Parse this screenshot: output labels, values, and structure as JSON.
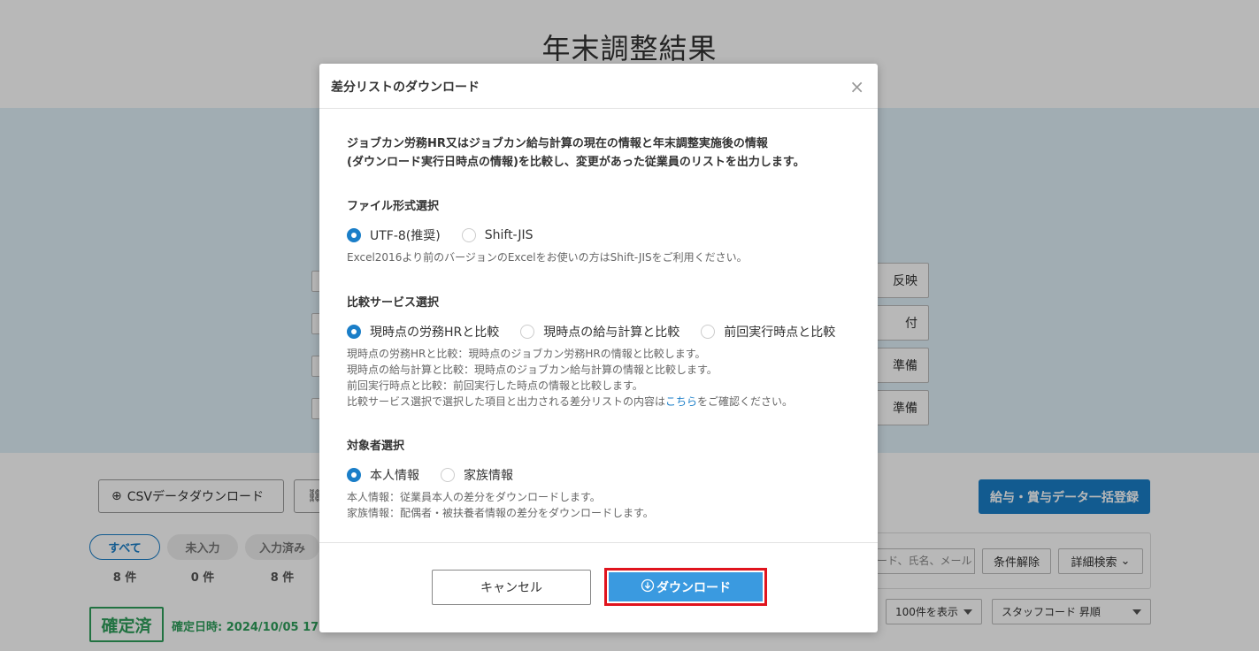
{
  "page": {
    "title": "年末調整結果",
    "right_buttons": [
      "反映",
      "付",
      "準備",
      "準備"
    ]
  },
  "toolbar": {
    "csv_download_label": "CSVデータダウンロード",
    "bulk_register_label": "給与・賞与データ一括登録"
  },
  "filters": [
    {
      "label": "すべて",
      "count": "8 件",
      "active": true
    },
    {
      "label": "未入力",
      "count": "0 件",
      "active": false
    },
    {
      "label": "入力済み",
      "count": "8 件",
      "active": false
    }
  ],
  "search": {
    "placeholder": "ード、氏名、メール",
    "clear_label": "条件解除",
    "advanced_label": "詳細検索"
  },
  "list_controls": {
    "per_page": "100件を表示",
    "sort": "スタッフコード 昇順"
  },
  "status": {
    "badge": "確定済",
    "date": "確定日時: 2024/10/05 17:"
  },
  "modal": {
    "title": "差分リストのダウンロード",
    "close": "×",
    "description_line1": "ジョブカン労務HR又はジョブカン給与計算の現在の情報と年末調整実施後の情報",
    "description_line2": "(ダウンロード実行日時点の情報)を比較し、変更があった従業員のリストを出力します。",
    "file_format": {
      "label": "ファイル形式選択",
      "options": [
        {
          "label": "UTF-8(推奨)",
          "checked": true
        },
        {
          "label": "Shift-JIS",
          "checked": false
        }
      ],
      "note": "Excel2016より前のバージョンのExcelをお使いの方はShift-JISをご利用ください。"
    },
    "compare_service": {
      "label": "比較サービス選択",
      "options": [
        {
          "label": "現時点の労務HRと比較",
          "checked": true
        },
        {
          "label": "現時点の給与計算と比較",
          "checked": false
        },
        {
          "label": "前回実行時点と比較",
          "checked": false
        }
      ],
      "notes": [
        "現時点の労務HRと比較：現時点のジョブカン労務HRの情報と比較します。",
        "現時点の給与計算と比較：現時点のジョブカン給与計算の情報と比較します。",
        "前回実行時点と比較：前回実行した時点の情報と比較します。"
      ],
      "note_last_before": "比較サービス選択で選択した項目と出力される差分リストの内容は",
      "note_link": "こちら",
      "note_last_after": "をご確認ください。"
    },
    "target": {
      "label": "対象者選択",
      "options": [
        {
          "label": "本人情報",
          "checked": true
        },
        {
          "label": "家族情報",
          "checked": false
        }
      ],
      "notes": [
        "本人情報：従業員本人の差分をダウンロードします。",
        "家族情報：配偶者・被扶養者情報の差分をダウンロードします。"
      ]
    },
    "cancel_label": "キャンセル",
    "download_label": "ダウンロード"
  },
  "colors": {
    "accent": "#1a7ec8",
    "highlight_frame": "#e0141e",
    "confirmed_green": "#2e9e5b"
  }
}
